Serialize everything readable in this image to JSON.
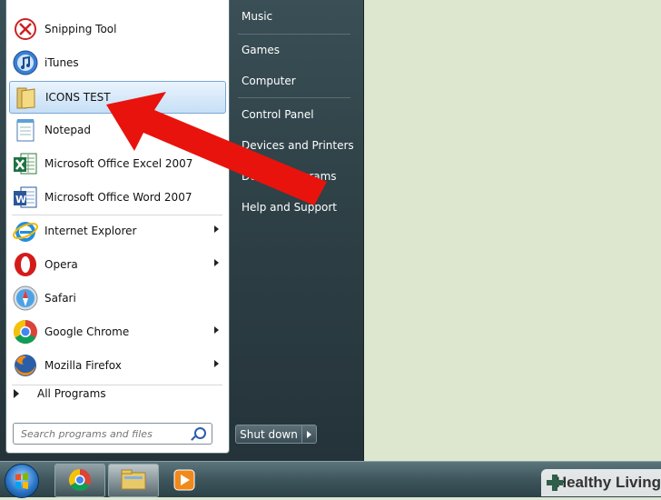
{
  "start_menu": {
    "pinned_programs": [
      {
        "label": "Snipping Tool",
        "icon": "snipping-tool-icon"
      },
      {
        "label": "iTunes",
        "icon": "itunes-icon"
      },
      {
        "label": "ICONS TEST",
        "icon": "folder-icon"
      },
      {
        "label": "Notepad",
        "icon": "notepad-icon"
      },
      {
        "label": "Microsoft Office Excel 2007",
        "icon": "excel-icon"
      },
      {
        "label": "Microsoft Office Word 2007",
        "icon": "word-icon"
      },
      {
        "label": "Internet Explorer",
        "icon": "internet-explorer-icon"
      },
      {
        "label": "Opera",
        "icon": "opera-icon"
      },
      {
        "label": "Safari",
        "icon": "safari-icon"
      },
      {
        "label": "Google Chrome",
        "icon": "chrome-icon"
      },
      {
        "label": "Mozilla Firefox",
        "icon": "firefox-icon"
      }
    ],
    "all_programs_label": "All Programs",
    "search_placeholder": "Search programs and files",
    "right_items": [
      "Music",
      "Games",
      "Computer",
      "Control Panel",
      "Devices and Printers",
      "Default Programs",
      "Help and Support"
    ],
    "shutdown_label": "Shut down"
  },
  "taskbar": {
    "items": [
      "chrome-icon",
      "folder-icon",
      "media-player-icon"
    ]
  },
  "watermark": {
    "text": "Healthy Living"
  },
  "colors": {
    "annotation_arrow": "#e8130d",
    "selection": "#c6dff6"
  }
}
